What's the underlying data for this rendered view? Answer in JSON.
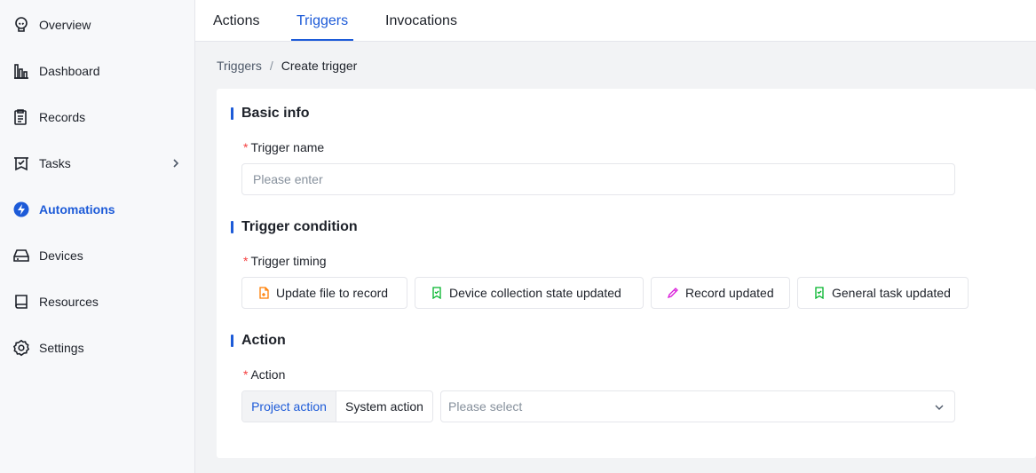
{
  "sidebar": {
    "items": [
      {
        "label": "Overview",
        "icon": "lightbulb-icon"
      },
      {
        "label": "Dashboard",
        "icon": "bar-chart-icon"
      },
      {
        "label": "Records",
        "icon": "clipboard-icon"
      },
      {
        "label": "Tasks",
        "icon": "task-icon"
      },
      {
        "label": "Automations",
        "icon": "lightning-icon"
      },
      {
        "label": "Devices",
        "icon": "device-icon"
      },
      {
        "label": "Resources",
        "icon": "book-icon"
      },
      {
        "label": "Settings",
        "icon": "gear-icon"
      }
    ],
    "active_index": 4
  },
  "tabs": [
    {
      "label": "Actions"
    },
    {
      "label": "Triggers"
    },
    {
      "label": "Invocations"
    }
  ],
  "breadcrumb": {
    "parent": "Triggers",
    "separator": "/",
    "current": "Create trigger"
  },
  "form": {
    "basic_info": {
      "title": "Basic info",
      "name_label": "Trigger name",
      "name_placeholder": "Please enter",
      "required_mark": "*"
    },
    "condition": {
      "title": "Trigger condition",
      "timing_label": "Trigger timing",
      "options": [
        {
          "label": "Update file to record",
          "icon": "file-upload-icon",
          "color": "#ff7d00"
        },
        {
          "label": "Device collection state updated",
          "icon": "bookmark-check-icon",
          "color": "#00b42a"
        },
        {
          "label": "Record updated",
          "icon": "pencil-icon",
          "color": "#d91ad9"
        },
        {
          "label": "General task updated",
          "icon": "bookmark-check-icon",
          "color": "#00b42a"
        }
      ]
    },
    "action": {
      "title": "Action",
      "action_label": "Action",
      "segments": [
        {
          "label": "Project action"
        },
        {
          "label": "System action"
        }
      ],
      "select_placeholder": "Please select"
    }
  },
  "colors": {
    "accent": "#1d5bd8",
    "required": "#f53f3f"
  }
}
